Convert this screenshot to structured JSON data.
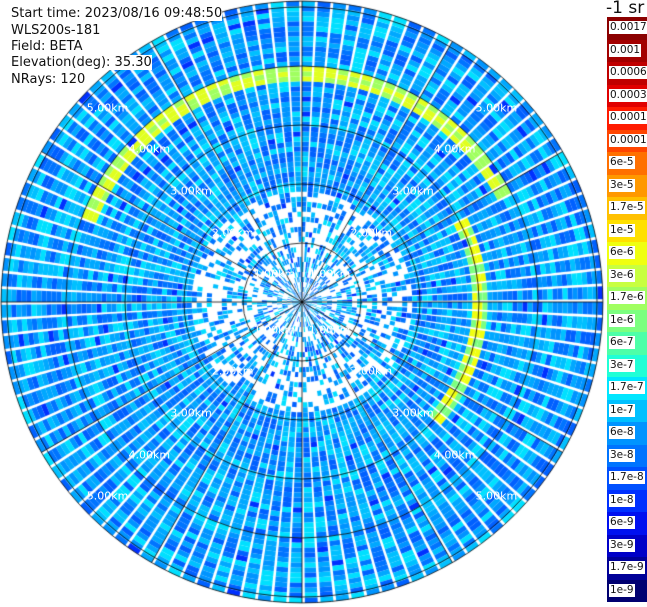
{
  "header": {
    "start_time": "Start time: 2023/08/16 09:48:50",
    "instrument": "WLS200s-181",
    "field": "Field: BETA",
    "elevation": "Elevation(deg): 35.30",
    "nrays": "NRays: 120"
  },
  "chart_data": {
    "type": "heatmap",
    "projection": "polar PPI",
    "n_rays": 120,
    "range_rings_km": [
      1,
      2,
      3,
      4,
      5
    ],
    "range_ring_labels": [
      "1.00km",
      "2.00km",
      "3.00km",
      "4.00km",
      "5.00km"
    ],
    "max_range_km": 5.1,
    "spoke_interval_deg": 30,
    "colorbar": {
      "unit": "-1 sr",
      "scale": "log",
      "labels": [
        "0.0017",
        "0.001",
        "0.0006",
        "0.0003",
        "0.00017",
        "0.0001",
        "6e-5",
        "3e-5",
        "1.7e-5",
        "1e-5",
        "6e-6",
        "3e-6",
        "1.7e-6",
        "1e-6",
        "6e-7",
        "3e-7",
        "1.7e-7",
        "1e-7",
        "6e-8",
        "3e-8",
        "1.7e-8",
        "1e-8",
        "6e-9",
        "3e-9",
        "1.7e-9",
        "1e-9"
      ],
      "colors": [
        "#8b0000",
        "#a30000",
        "#c00000",
        "#e00000",
        "#ff1a00",
        "#ff4500",
        "#ff7000",
        "#ff9800",
        "#ffc000",
        "#ffe000",
        "#f0ff10",
        "#c8ff40",
        "#a0ff60",
        "#7cff80",
        "#4dffa8",
        "#20ffd6",
        "#00e6ff",
        "#00c0ff",
        "#0094ff",
        "#0074ff",
        "#0050ff",
        "#0030ff",
        "#0010f0",
        "#0000c8",
        "#000098",
        "#000070"
      ]
    }
  }
}
